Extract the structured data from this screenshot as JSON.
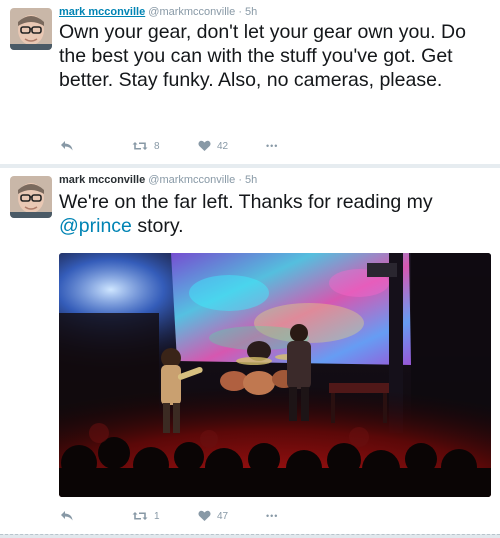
{
  "tweets": [
    {
      "author_name": "mark mcconville",
      "handle": "@markmcconville",
      "dot": "·",
      "time": "5h",
      "text": "Own your gear, don't let your gear own you. Do the best you can with the stuff you've got. Get better. Stay funky. Also, no cameras, please.",
      "retweets": "8",
      "likes": "42",
      "more": "•••"
    },
    {
      "author_name": "mark mcconville",
      "handle": "@markmcconville",
      "dot": "·",
      "time": "5h",
      "text_before": "We're on the far left. Thanks for reading my",
      "mention": "@prince",
      "text_after": " story.",
      "retweets": "1",
      "likes": "47",
      "more": "•••"
    }
  ],
  "icons": {
    "reply": "reply-icon",
    "retweet": "retweet-icon",
    "like": "heart-icon",
    "more": "more-icon"
  },
  "colors": {
    "link": "#0084b4",
    "meta": "#8899a6",
    "text": "#14171a"
  }
}
